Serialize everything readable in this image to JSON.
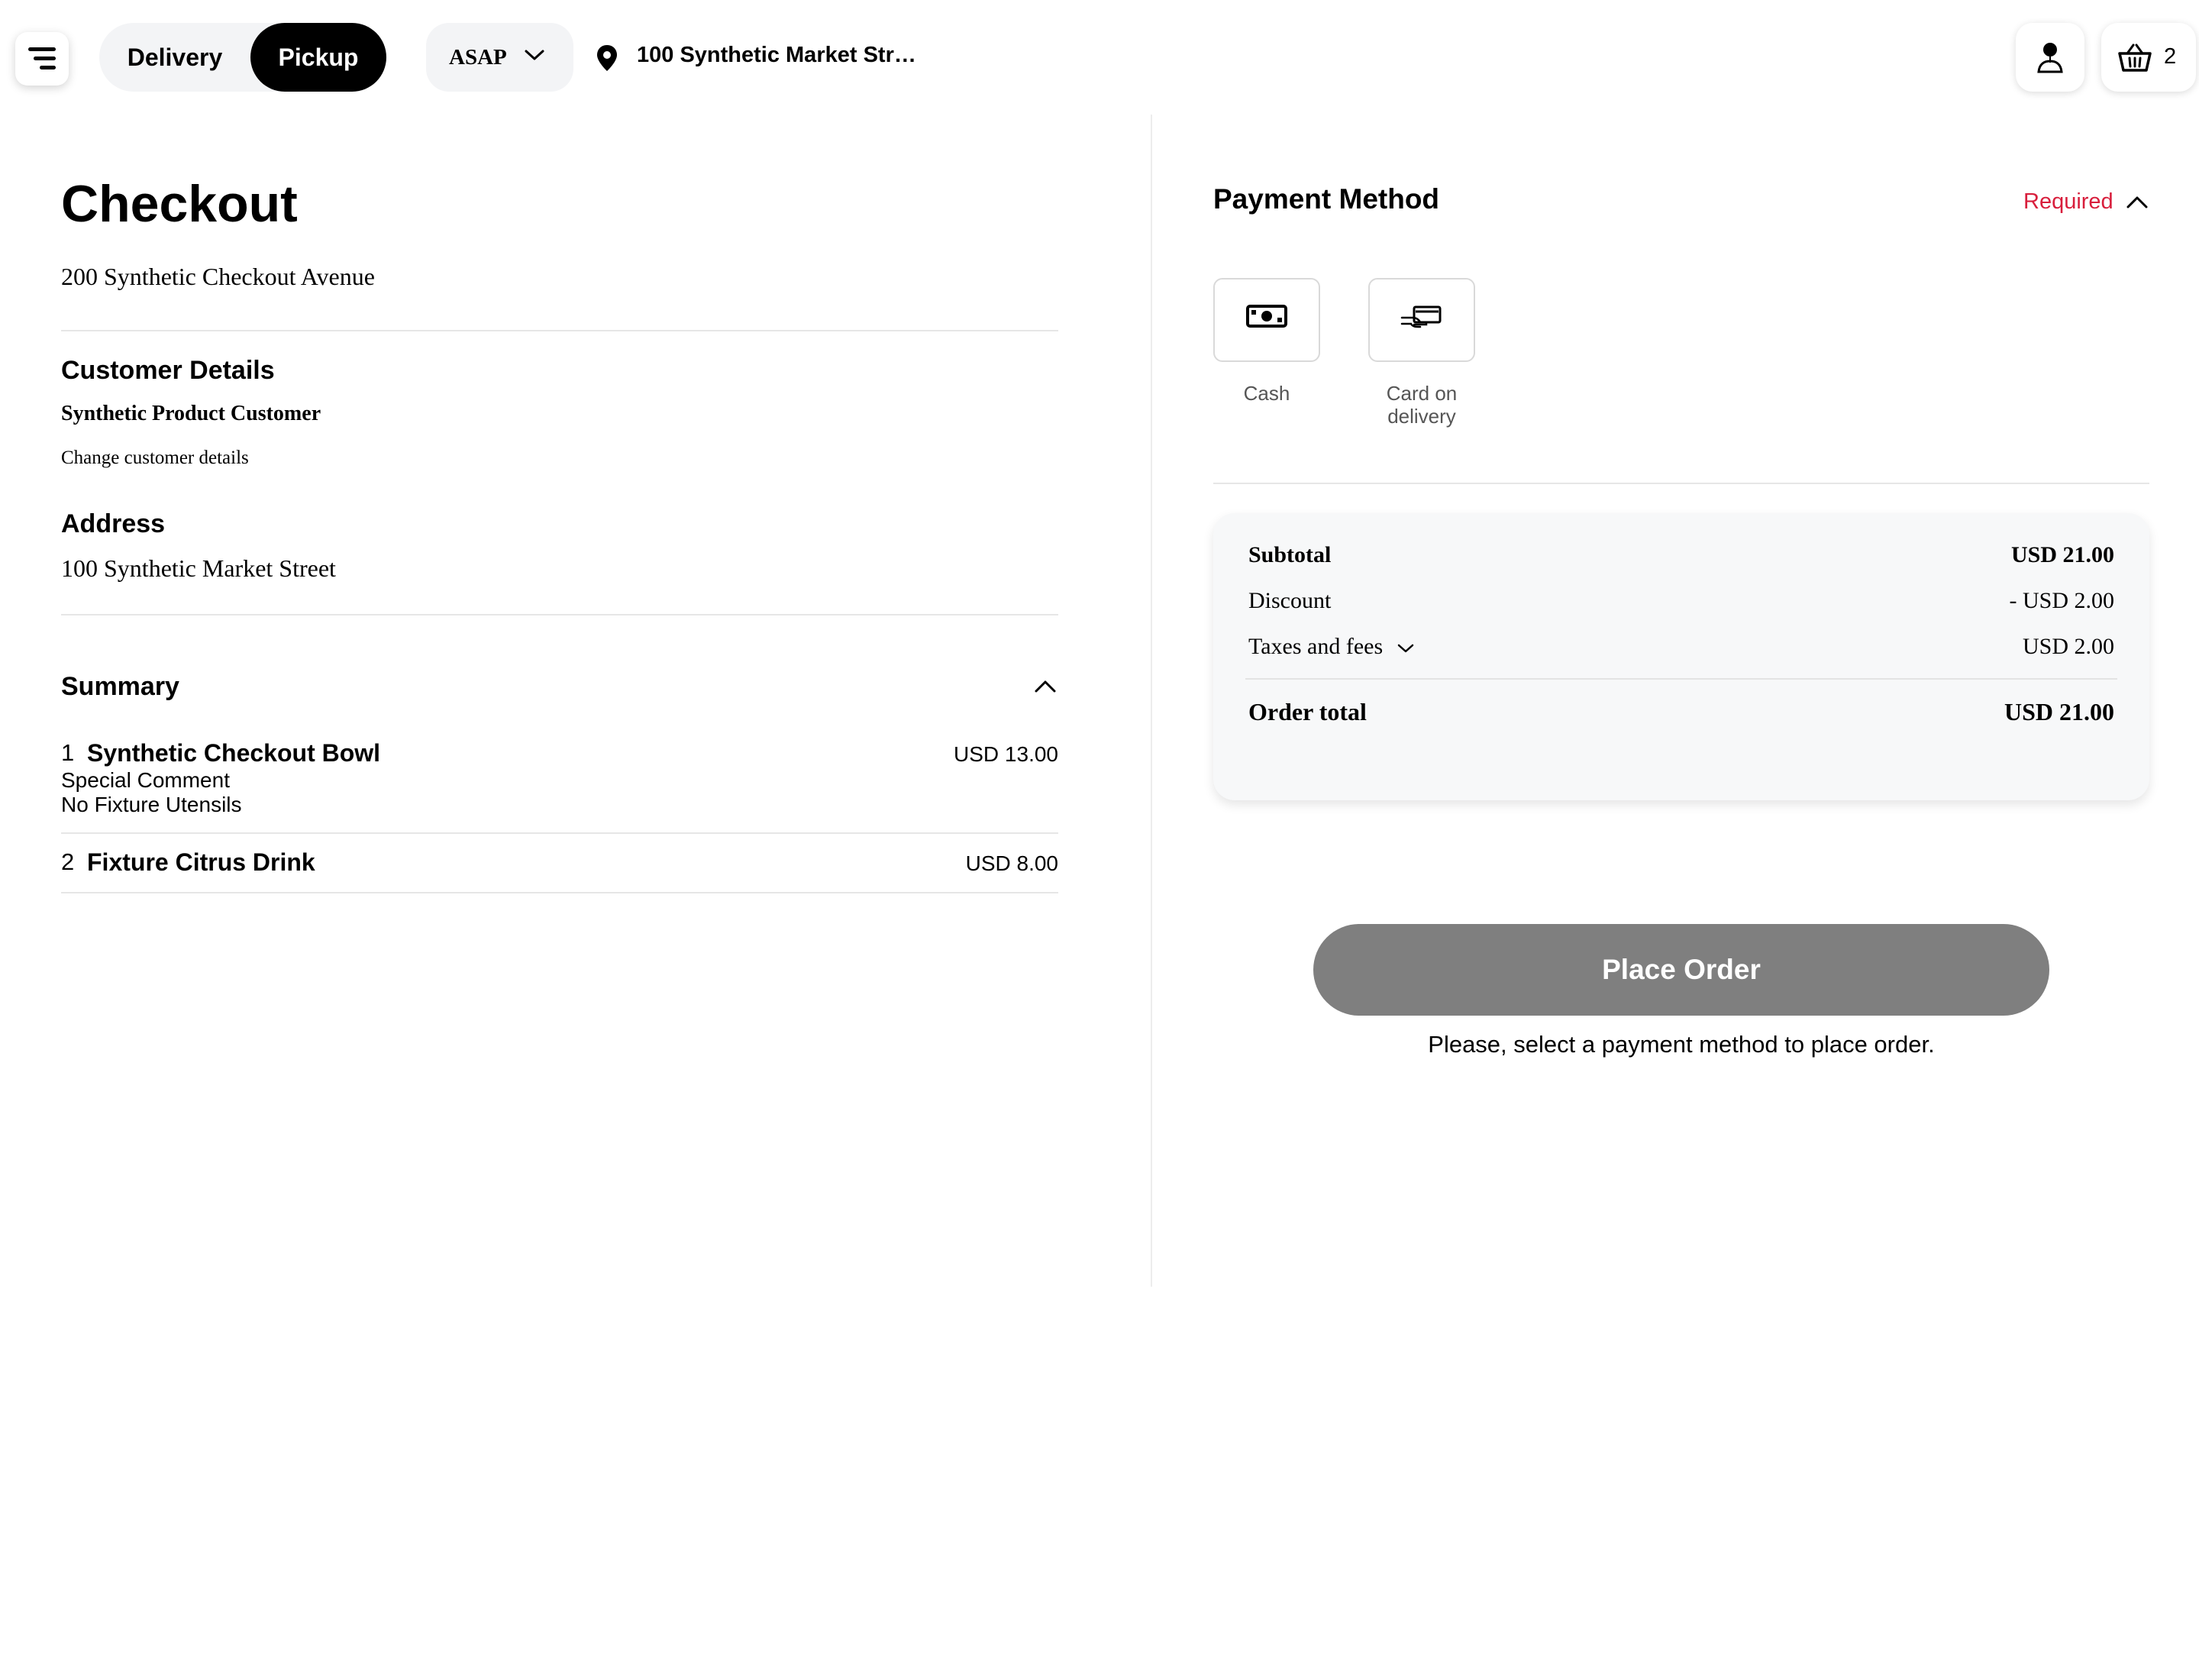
{
  "header": {
    "order_modes": [
      "Delivery",
      "Pickup"
    ],
    "selected_mode": "Pickup",
    "time_value": "ASAP",
    "location": "100 Synthetic Market Str…",
    "cart_count": "2"
  },
  "checkout": {
    "title": "Checkout",
    "store_address": "200 Synthetic Checkout Avenue",
    "customer_details_title": "Customer Details",
    "customer_name": "Synthetic Product Customer",
    "change_link": "Change customer details",
    "address_title": "Address",
    "address": "100 Synthetic Market Street",
    "summary_title": "Summary",
    "items": [
      {
        "qty": "1",
        "name": "Synthetic Checkout Bowl",
        "price": "USD 13.00",
        "modifiers": [
          "Special Comment",
          "No Fixture Utensils"
        ]
      },
      {
        "qty": "2",
        "name": "Fixture Citrus Drink",
        "price": "USD 8.00",
        "modifiers": []
      }
    ]
  },
  "payment": {
    "title": "Payment Method",
    "required": "Required",
    "options": [
      {
        "icon": "cash-icon",
        "label_line1": "Cash",
        "label_line2": ""
      },
      {
        "icon": "card-on-delivery-icon",
        "label_line1": "Card on",
        "label_line2": "delivery"
      }
    ]
  },
  "totals": {
    "subtotal_label": "Subtotal",
    "subtotal": "USD 21.00",
    "discount_label": "Discount",
    "discount": "- USD 2.00",
    "taxes_label": "Taxes and fees",
    "taxes": "USD 2.00",
    "total_label": "Order total",
    "total": "USD 21.00"
  },
  "actions": {
    "place_order": "Place Order",
    "hint": "Please, select a payment method to place order."
  },
  "colors": {
    "accent_required": "#d81e3c",
    "button_disabled": "#7f7f7f",
    "selected_mode_bg": "#000000"
  }
}
